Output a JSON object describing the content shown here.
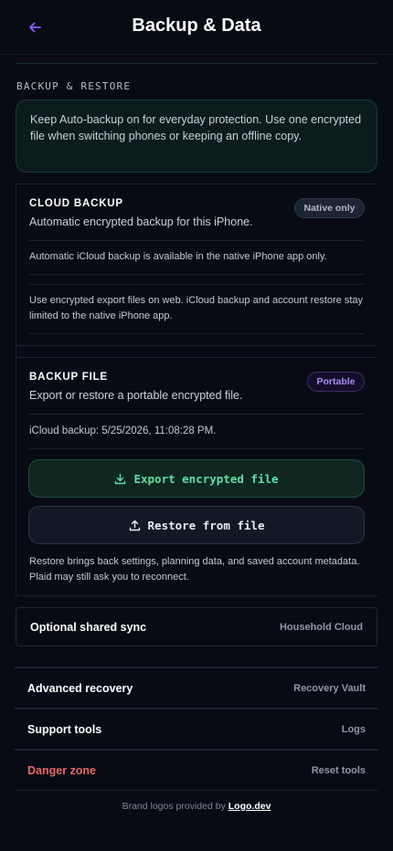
{
  "header": {
    "title": "Backup & Data"
  },
  "section": {
    "label": "BACKUP & RESTORE"
  },
  "tip": {
    "text": "Keep Auto-backup on for everyday protection. Use one encrypted file when switching phones or keeping an offline copy."
  },
  "cloud_backup": {
    "title": "CLOUD BACKUP",
    "subtitle": "Automatic encrypted backup for this iPhone.",
    "badge": "Native only",
    "note": "Automatic iCloud backup is available in the native iPhone app only.",
    "web_note": "Use encrypted export files on web. iCloud backup and account restore stay limited to the native iPhone app."
  },
  "backup_file": {
    "title": "BACKUP FILE",
    "subtitle": "Export or restore a portable encrypted file.",
    "badge": "Portable",
    "last_backup": "iCloud backup: 5/25/2026, 11:08:28 PM.",
    "export_label": "Export encrypted file",
    "restore_label": "Restore from file",
    "restore_note": "Restore brings back settings, planning data, and saved account metadata. Plaid may still ask you to reconnect."
  },
  "sync": {
    "label": "Optional shared sync",
    "value": "Household Cloud"
  },
  "rows": [
    {
      "label": "Advanced recovery",
      "value": "Recovery Vault"
    },
    {
      "label": "Support tools",
      "value": "Logs"
    },
    {
      "label": "Danger zone",
      "value": "Reset tools"
    }
  ],
  "footer": {
    "prefix": "Brand logos provided by",
    "link": "Logo.dev"
  },
  "colors": {
    "background": "#080b14",
    "accent_purple": "#8b5cf6",
    "accent_green": "#5fe0a6",
    "danger": "#e86767"
  },
  "icons": {
    "back": "arrow-left-icon",
    "export": "download-icon",
    "restore": "upload-icon"
  }
}
